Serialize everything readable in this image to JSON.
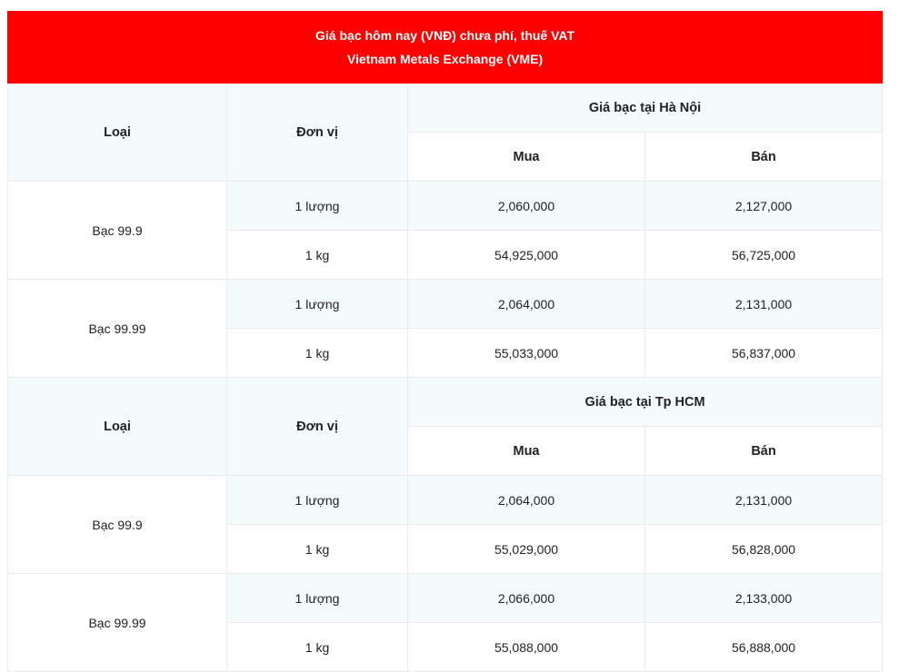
{
  "header": {
    "title_line1": "Giá bạc hôm nay (VNĐ) chưa phí, thuế VAT",
    "title_line2": "Vietnam Metals Exchange (VME)"
  },
  "colors": {
    "title_bg": "#ff0000",
    "row_tint": "#f3fbfd",
    "border": "#ebebeb"
  },
  "sections": [
    {
      "col_type": "Loại",
      "col_unit": "Đơn vị",
      "location": "Giá bạc tại Hà Nội",
      "col_buy": "Mua",
      "col_sell": "Bán",
      "groups": [
        {
          "type": "Bạc 99.9",
          "rows": [
            {
              "unit": "1 lượng",
              "buy": "2,060,000",
              "sell": "2,127,000"
            },
            {
              "unit": "1 kg",
              "buy": "54,925,000",
              "sell": "56,725,000"
            }
          ]
        },
        {
          "type": "Bạc 99.99",
          "rows": [
            {
              "unit": "1 lượng",
              "buy": "2,064,000",
              "sell": "2,131,000"
            },
            {
              "unit": "1 kg",
              "buy": "55,033,000",
              "sell": "56,837,000"
            }
          ]
        }
      ]
    },
    {
      "col_type": "Loại",
      "col_unit": "Đơn vị",
      "location": "Giá bạc tại Tp HCM",
      "col_buy": "Mua",
      "col_sell": "Bán",
      "groups": [
        {
          "type": "Bạc 99.9",
          "rows": [
            {
              "unit": "1 lượng",
              "buy": "2,064,000",
              "sell": "2,131,000"
            },
            {
              "unit": "1 kg",
              "buy": "55,029,000",
              "sell": "56,828,000"
            }
          ]
        },
        {
          "type": "Bạc 99.99",
          "rows": [
            {
              "unit": "1 lượng",
              "buy": "2,066,000",
              "sell": "2,133,000"
            },
            {
              "unit": "1 kg",
              "buy": "55,088,000",
              "sell": "56,888,000"
            }
          ]
        }
      ]
    }
  ]
}
